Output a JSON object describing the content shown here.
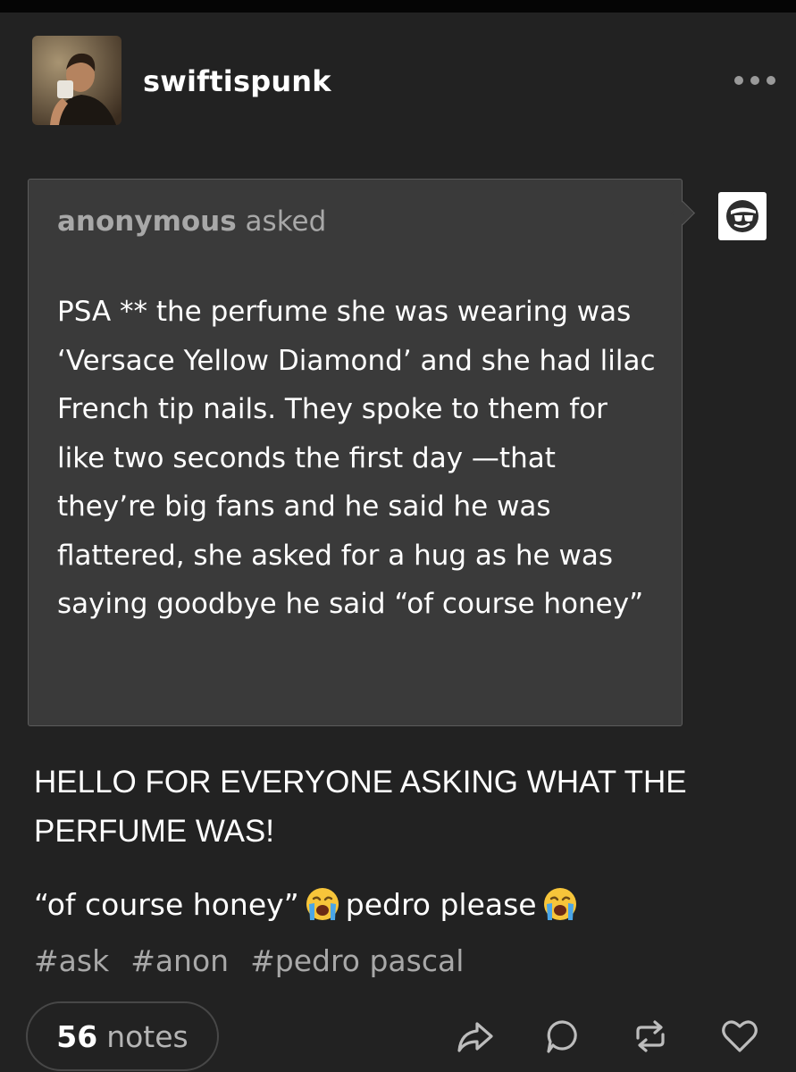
{
  "post": {
    "username": "swiftispunk"
  },
  "ask": {
    "asker_name": "anonymous",
    "asker_verb": "asked",
    "question": "PSA ** the perfume she was wearing was ‘Versace Yellow Diamond’ and she had lilac French tip nails.  They spoke to them for like two seconds the first day —that they’re big fans and he said he was flattered, she asked for a hug as he was saying goodbye he said “of course honey”"
  },
  "answer": {
    "line1": "HELLO FOR EVERYONE ASKING WHAT THE PERFUME WAS!",
    "line2_part1": "“of course honey”",
    "line2_part2": "pedro please"
  },
  "tags": [
    "#ask",
    "#anon",
    "#pedro pascal"
  ],
  "footer": {
    "notes_count": "56",
    "notes_label": "notes"
  },
  "icons": {
    "more": "more-horizontal-icon",
    "emoji": "loudly-crying-face-emoji",
    "share": "share-arrow-icon",
    "reply": "reply-bubble-icon",
    "reblog": "reblog-icon",
    "like": "heart-icon",
    "anon_avatar": "sunglasses-face-icon"
  },
  "colors": {
    "background": "#222222",
    "ask_background": "#3a3a3a",
    "muted_text": "#a8a8a8",
    "text": "#ffffff"
  }
}
